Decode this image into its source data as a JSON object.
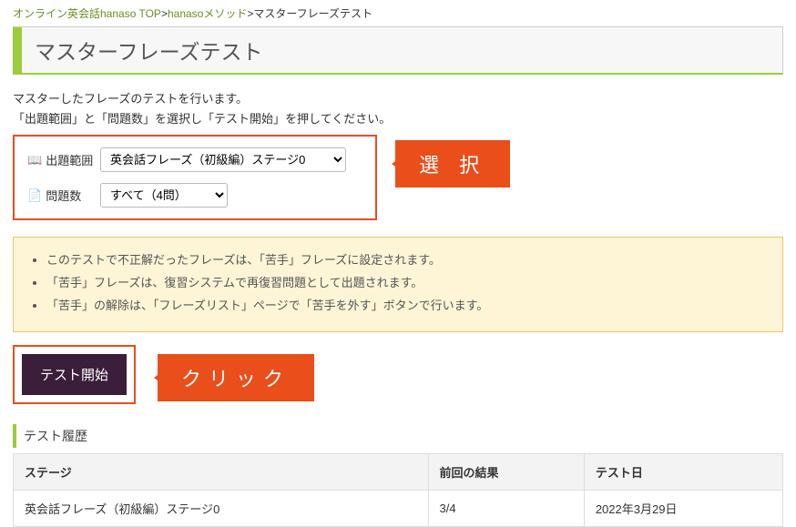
{
  "breadcrumb": {
    "top": "オンライン英会話hanaso TOP",
    "sep1": ">",
    "method": "hanasoメソッド",
    "sep2": ">",
    "current": "マスターフレーズテスト"
  },
  "page_title": "マスターフレーズテスト",
  "description": {
    "line1": "マスターしたフレーズのテストを行います。",
    "line2": "「出題範囲」と「問題数」を選択し「テスト開始」を押してください。"
  },
  "form": {
    "range_label": "出題範囲",
    "range_value": "英会話フレーズ（初級編）ステージ0",
    "count_label": "問題数",
    "count_value": "すべて（4問）"
  },
  "callout_select": "選 択",
  "info": {
    "item1": "このテストで不正解だったフレーズは、「苦手」フレーズに設定されます。",
    "item2": "「苦手」フレーズは、復習システムで再復習問題として出題されます。",
    "item3": "「苦手」の解除は、「フレーズリスト」ページで「苦手を外す」ボタンで行います。"
  },
  "start_button": "テスト開始",
  "callout_click": "クリック",
  "history": {
    "title": "テスト履歴",
    "headers": {
      "stage": "ステージ",
      "result": "前回の結果",
      "date": "テスト日"
    },
    "rows": [
      {
        "stage": "英会話フレーズ（初級編）ステージ0",
        "result": "3/4",
        "date": "2022年3月29日"
      }
    ]
  }
}
